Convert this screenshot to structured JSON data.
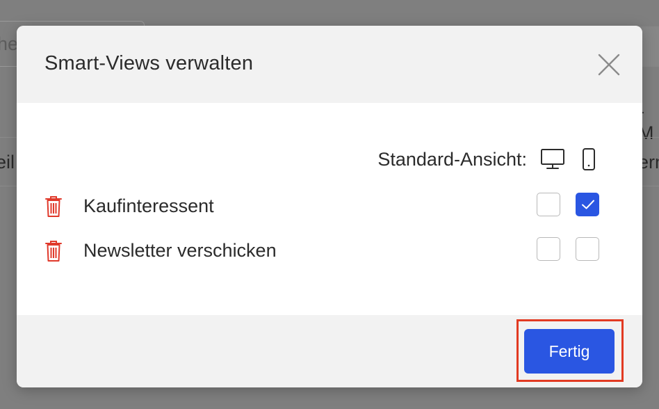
{
  "background": {
    "search_partial_text": "he",
    "column_header_partial": "-M",
    "cell_left_partial": "eil",
    "cell_right_partial": "ern"
  },
  "dialog": {
    "title": "Smart-Views verwalten",
    "close_icon": "close-icon",
    "default_view_label": "Standard-Ansicht:",
    "device_icons": [
      "desktop-icon",
      "mobile-icon"
    ],
    "views": [
      {
        "name": "Kaufinteressent",
        "desktop_default": false,
        "mobile_default": true
      },
      {
        "name": "Newsletter verschicken",
        "desktop_default": false,
        "mobile_default": false
      }
    ],
    "done_label": "Fertig"
  },
  "colors": {
    "accent": "#2a56e2",
    "delete": "#e0392b",
    "highlight": "#e23a22",
    "overlay": "#7f7f7f"
  }
}
